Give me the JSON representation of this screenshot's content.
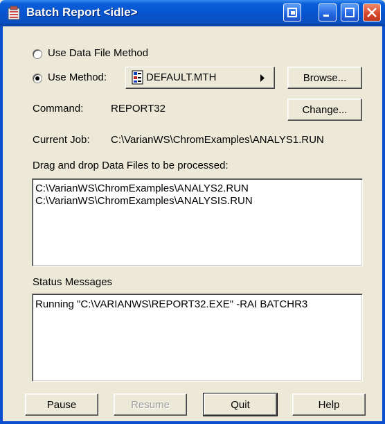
{
  "window": {
    "title": "Batch Report <idle>"
  },
  "options": {
    "data_file_method_label": "Use Data File Method",
    "use_method_label": "Use Method:",
    "method_name": "DEFAULT.MTH",
    "browse_label": "Browse..."
  },
  "command": {
    "label": "Command:",
    "value": "REPORT32",
    "change_label": "Change..."
  },
  "current_job": {
    "label": "Current Job:",
    "value": "C:\\VarianWS\\ChromExamples\\ANALYS1.RUN"
  },
  "drop_area": {
    "label": "Drag and drop Data Files to be processed:",
    "files": [
      "C:\\VarianWS\\ChromExamples\\ANALYS2.RUN",
      "C:\\VarianWS\\ChromExamples\\ANALYSIS.RUN"
    ]
  },
  "status": {
    "label": "Status Messages",
    "messages": [
      "Running \"C:\\VARIANWS\\REPORT32.EXE\" -RAI BATCHR3"
    ]
  },
  "buttons": {
    "pause": "Pause",
    "resume": "Resume",
    "quit": "Quit",
    "help": "Help"
  }
}
